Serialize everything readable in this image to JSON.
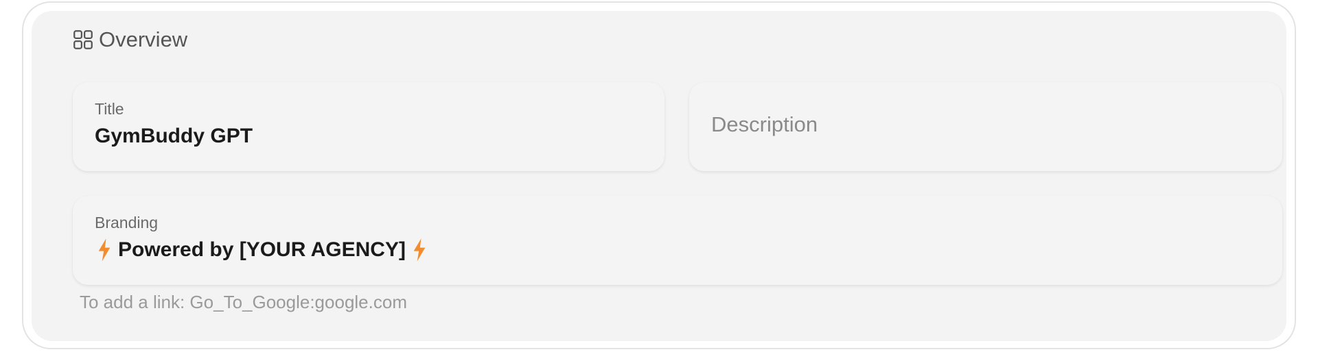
{
  "overview": {
    "heading": "Overview",
    "icon": "grid-icon"
  },
  "title_field": {
    "label": "Title",
    "value": "GymBuddy GPT"
  },
  "description_field": {
    "placeholder": "Description",
    "value": ""
  },
  "branding_field": {
    "label": "Branding",
    "value": "Powered by [YOUR AGENCY]",
    "prefix_icon": "lightning-bolt-icon",
    "suffix_icon": "lightning-bolt-icon",
    "icon_color": "#F28C2E"
  },
  "hint": {
    "text": "To add a link: Go_To_Google:google.com"
  }
}
